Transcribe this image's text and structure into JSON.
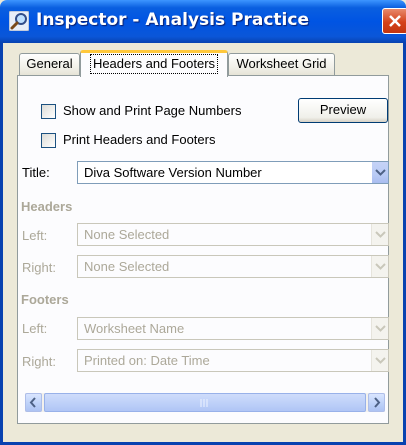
{
  "window": {
    "title": "Inspector - Analysis Practice",
    "icon": "magnifier-icon",
    "close": "close-icon"
  },
  "tabs": [
    {
      "label": "General",
      "active": false
    },
    {
      "label": "Headers and Footers",
      "active": true
    },
    {
      "label": "Worksheet Grid",
      "active": false
    }
  ],
  "options": {
    "show_page_numbers": {
      "label": "Show and Print Page Numbers",
      "checked": false
    },
    "print_headers_footers": {
      "label": "Print Headers and Footers",
      "checked": false
    },
    "preview_button": "Preview"
  },
  "title_field": {
    "label": "Title:",
    "value": "Diva Software Version Number"
  },
  "headers": {
    "heading": "Headers",
    "left": {
      "label": "Left:",
      "value": "None Selected"
    },
    "right": {
      "label": "Right:",
      "value": "None Selected"
    }
  },
  "footers": {
    "heading": "Footers",
    "left": {
      "label": "Left:",
      "value": "Worksheet Name"
    },
    "right": {
      "label": "Right:",
      "value": "Printed on: Date Time"
    }
  },
  "colors": {
    "titlebar": "#0054e3",
    "close": "#d4421a",
    "disabled_text": "#aca899"
  }
}
